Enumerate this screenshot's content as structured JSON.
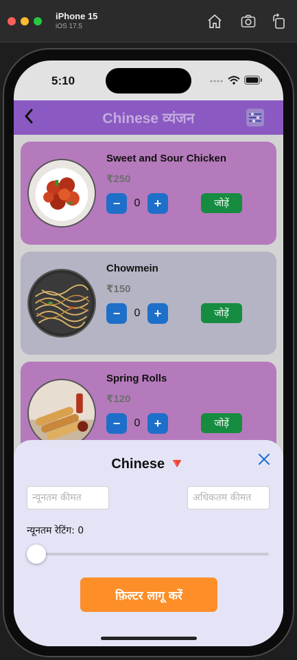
{
  "simulator": {
    "device_name": "iPhone 15",
    "os_version": "iOS 17.5",
    "icons": [
      "home-icon",
      "screenshot-icon",
      "rotate-icon"
    ]
  },
  "status_bar": {
    "time": "5:10",
    "icons": [
      "signal-icon",
      "wifi-icon",
      "battery-icon"
    ]
  },
  "nav": {
    "title": "Chinese व्यंजन",
    "back_icon": "chevron-left-icon",
    "filter_icon": "filter-icon"
  },
  "items": [
    {
      "name": "Sweet and Sour Chicken",
      "price": "₹250",
      "quantity": "0",
      "add_label": "जोड़ें",
      "card_color": "#b57abc"
    },
    {
      "name": "Chowmein",
      "price": "₹150",
      "quantity": "0",
      "add_label": "जोड़ें",
      "card_color": "#b4b4c4"
    },
    {
      "name": "Spring Rolls",
      "price": "₹120",
      "quantity": "0",
      "add_label": "जोड़ें",
      "card_color": "#b57abc"
    }
  ],
  "stepper": {
    "minus": "−",
    "plus": "+"
  },
  "filter_sheet": {
    "title": "Chinese 🔻",
    "min_price_placeholder": "न्यूनतम कीमत",
    "max_price_placeholder": "अधिकतम कीमत",
    "rating_label": "न्यूनतम रेटिंग: 0",
    "rating_value": 0,
    "apply_label": "फ़िल्टर लागू करें"
  },
  "colors": {
    "nav_bar": "#8a59c2",
    "stepper": "#1e6fc9",
    "add_button": "#168c40",
    "apply_button": "#fe8e28",
    "sheet": "#e4e4f6"
  }
}
